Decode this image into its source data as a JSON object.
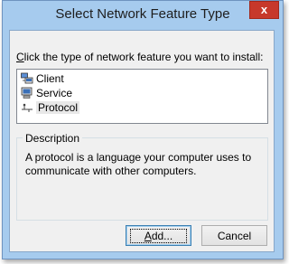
{
  "dialog": {
    "title": "Select Network Feature Type",
    "close_glyph": "x"
  },
  "prompt": {
    "accelerator": "C",
    "rest": "lick the type of network feature you want to install:"
  },
  "features": [
    {
      "label": "Client",
      "icon": "client-computer-icon",
      "selected": false
    },
    {
      "label": "Service",
      "icon": "service-computer-icon",
      "selected": false
    },
    {
      "label": "Protocol",
      "icon": "protocol-network-icon",
      "selected": true
    }
  ],
  "description": {
    "heading": "Description",
    "text": "A protocol is a language your computer uses to communicate with other computers."
  },
  "buttons": {
    "add_accelerator": "A",
    "add_rest": "dd...",
    "cancel": "Cancel"
  },
  "colors": {
    "titlebar": "#a6cbee",
    "close": "#c7382b",
    "dialog_bg": "#f0f0f0"
  }
}
